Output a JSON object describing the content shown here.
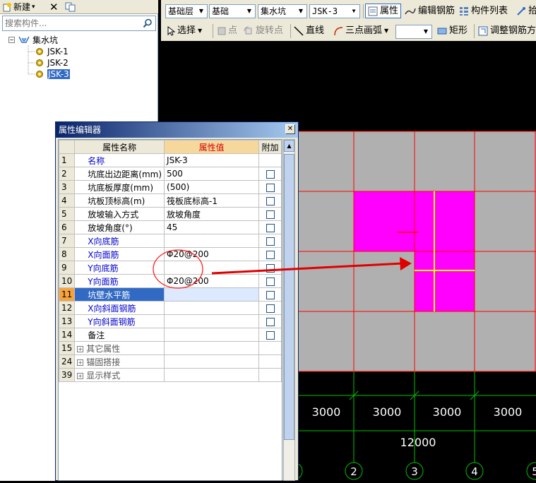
{
  "left_toolbar": {
    "new_label": "新建",
    "new_arrow": "▾",
    "delete_icon": "✕",
    "copy_icon": "copy"
  },
  "search": {
    "placeholder": "搜索构件..."
  },
  "tree": {
    "root": {
      "expander": "−",
      "label": "集水坑"
    },
    "children": [
      {
        "label": "JSK-1"
      },
      {
        "label": "JSK-2"
      },
      {
        "label": "JSK-3",
        "selected": true
      }
    ]
  },
  "top_toolbar": {
    "row1": {
      "combo_layer": "基础层",
      "combo_category": "基础",
      "combo_type": "集水坑",
      "combo_item": "JSK-3",
      "btn_property": "属性",
      "btn_edit_rebar": "编辑钢筋",
      "btn_component_list": "构件列表",
      "btn_pick": "拾"
    },
    "row2": {
      "btn_select": "选择",
      "btn_point": "点",
      "btn_rotate_point": "旋转点",
      "btn_line": "直线",
      "btn_arc": "三点画弧",
      "combo_blank": "",
      "btn_rect": "矩形",
      "btn_adjust_rebar": "调整钢筋方"
    }
  },
  "property_dialog": {
    "title": "属性编辑器",
    "close": "✕",
    "headers": {
      "name": "属性名称",
      "value": "属性值",
      "add": "附加"
    },
    "rows": [
      {
        "num": "1",
        "name": "名称",
        "value": "JSK-3",
        "blue": true,
        "checkbox": false
      },
      {
        "num": "2",
        "name": "坑底出边距离(mm)",
        "value": "500",
        "blue": false,
        "checkbox": true
      },
      {
        "num": "3",
        "name": "坑底板厚度(mm)",
        "value": "(500)",
        "blue": false,
        "checkbox": true
      },
      {
        "num": "4",
        "name": "坑板顶标高(m)",
        "value": "筏板底标高-1",
        "blue": false,
        "checkbox": true
      },
      {
        "num": "5",
        "name": "放坡输入方式",
        "value": "放坡角度",
        "blue": false,
        "checkbox": true
      },
      {
        "num": "6",
        "name": "放坡角度(°)",
        "value": "45",
        "blue": false,
        "checkbox": true
      },
      {
        "num": "7",
        "name": "X向底筋",
        "value": "",
        "blue": true,
        "checkbox": true
      },
      {
        "num": "8",
        "name": "X向面筋",
        "value": "Φ20@200",
        "blue": true,
        "checkbox": true
      },
      {
        "num": "9",
        "name": "Y向底筋",
        "value": "",
        "blue": true,
        "checkbox": true
      },
      {
        "num": "10",
        "name": "Y向面筋",
        "value": "Φ20@200",
        "blue": true,
        "checkbox": true
      },
      {
        "num": "11",
        "name": "坑壁水平筋",
        "value": "",
        "blue": true,
        "checkbox": true,
        "selected": true
      },
      {
        "num": "12",
        "name": "X向斜面钢筋",
        "value": "",
        "blue": true,
        "checkbox": true
      },
      {
        "num": "13",
        "name": "Y向斜面钢筋",
        "value": "",
        "blue": true,
        "checkbox": true
      },
      {
        "num": "14",
        "name": "备注",
        "value": "",
        "blue": false,
        "checkbox": true
      }
    ],
    "groups": [
      {
        "num": "15",
        "label": "其它属性"
      },
      {
        "num": "24",
        "label": "锚固搭接"
      },
      {
        "num": "39",
        "label": "显示样式"
      }
    ]
  },
  "canvas": {
    "dimensions": [
      "3000",
      "3000",
      "3000",
      "3000"
    ],
    "total_dimension": "12000",
    "axis_labels": [
      "2",
      "3",
      "4",
      "5"
    ],
    "colors": {
      "slab": "#b0b0b0",
      "pit": "#ff00ff",
      "grid": "#ff0000",
      "rebar": "#ffff00",
      "dim": "#00c000",
      "arrow": "#ff0000"
    }
  }
}
